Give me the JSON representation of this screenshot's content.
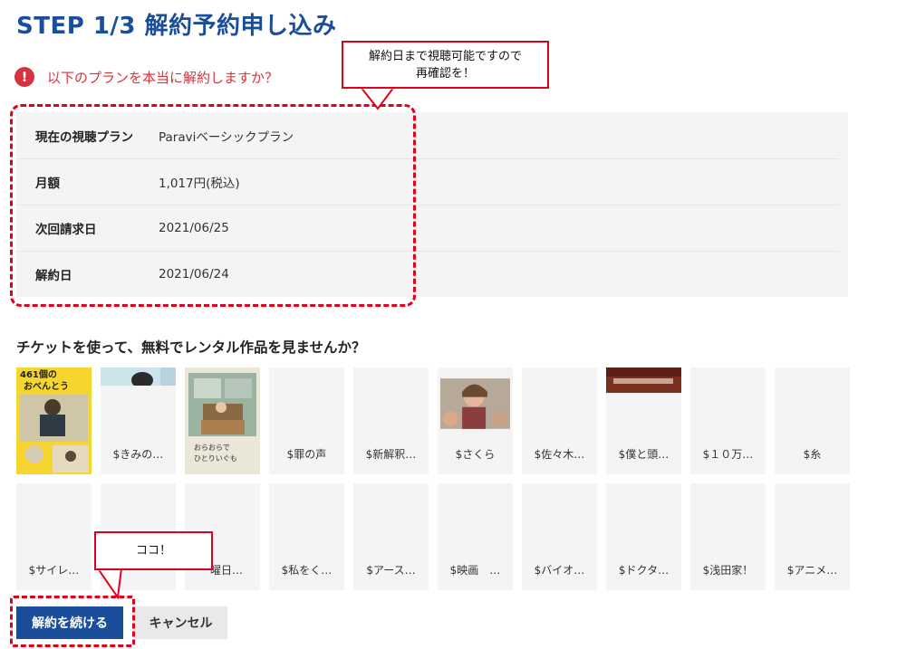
{
  "page": {
    "title": "STEP 1/3 解約予約申し込み",
    "warning": "以下のプランを本当に解約しますか？"
  },
  "plan": {
    "rows": [
      {
        "label": "現在の視聴プラン",
        "value": "Paraviベーシックプラン"
      },
      {
        "label": "月額",
        "value": "1,017円(税込)"
      },
      {
        "label": "次回請求日",
        "value": "2021/06/25"
      },
      {
        "label": "解約日",
        "value": "2021/06/24"
      }
    ]
  },
  "annotations": {
    "callout_plan_line1": "解約日まで視聴可能ですので",
    "callout_plan_line2": "再確認を！",
    "callout_button": "ココ！"
  },
  "tickets": {
    "heading": "チケットを使って、無料でレンタル作品を見ませんか？",
    "row1": [
      {
        "title": "",
        "thumb": "poster-461-icon",
        "thumb_text_1": "461個の",
        "thumb_text_2": "おべんとう"
      },
      {
        "title": "$きみの…",
        "thumb": "strip-photo-icon"
      },
      {
        "title": "",
        "thumb": "poster-ohitori-icon",
        "thumb_text_1": "おらおらで",
        "thumb_text_2": "ひとりいぐも"
      },
      {
        "title": "$罪の声",
        "thumb": ""
      },
      {
        "title": "$新解釈…",
        "thumb": ""
      },
      {
        "title": "$さくら",
        "thumb": "photo-sakura-icon"
      },
      {
        "title": "$佐々木…",
        "thumb": ""
      },
      {
        "title": "$僕と頭…",
        "thumb": "strip-dark-icon"
      },
      {
        "title": "$１０万…",
        "thumb": ""
      },
      {
        "title": "$糸",
        "thumb": ""
      }
    ],
    "row2": [
      {
        "title": "$サイレ…"
      },
      {
        "title": ""
      },
      {
        "title": "曜日…"
      },
      {
        "title": "$私をく…"
      },
      {
        "title": "$アース…"
      },
      {
        "title": "$映画　…"
      },
      {
        "title": "$バイオ…"
      },
      {
        "title": "$ドクタ…"
      },
      {
        "title": "$浅田家！"
      },
      {
        "title": "$アニメ…"
      }
    ]
  },
  "buttons": {
    "continue_label": "解約を続ける",
    "cancel_label": "キャンセル"
  },
  "colors": {
    "brand_blue": "#1a4d9a",
    "warning_red": "#d6333f",
    "annotation_red": "#e0001b",
    "panel_gray": "#f4f4f4"
  }
}
